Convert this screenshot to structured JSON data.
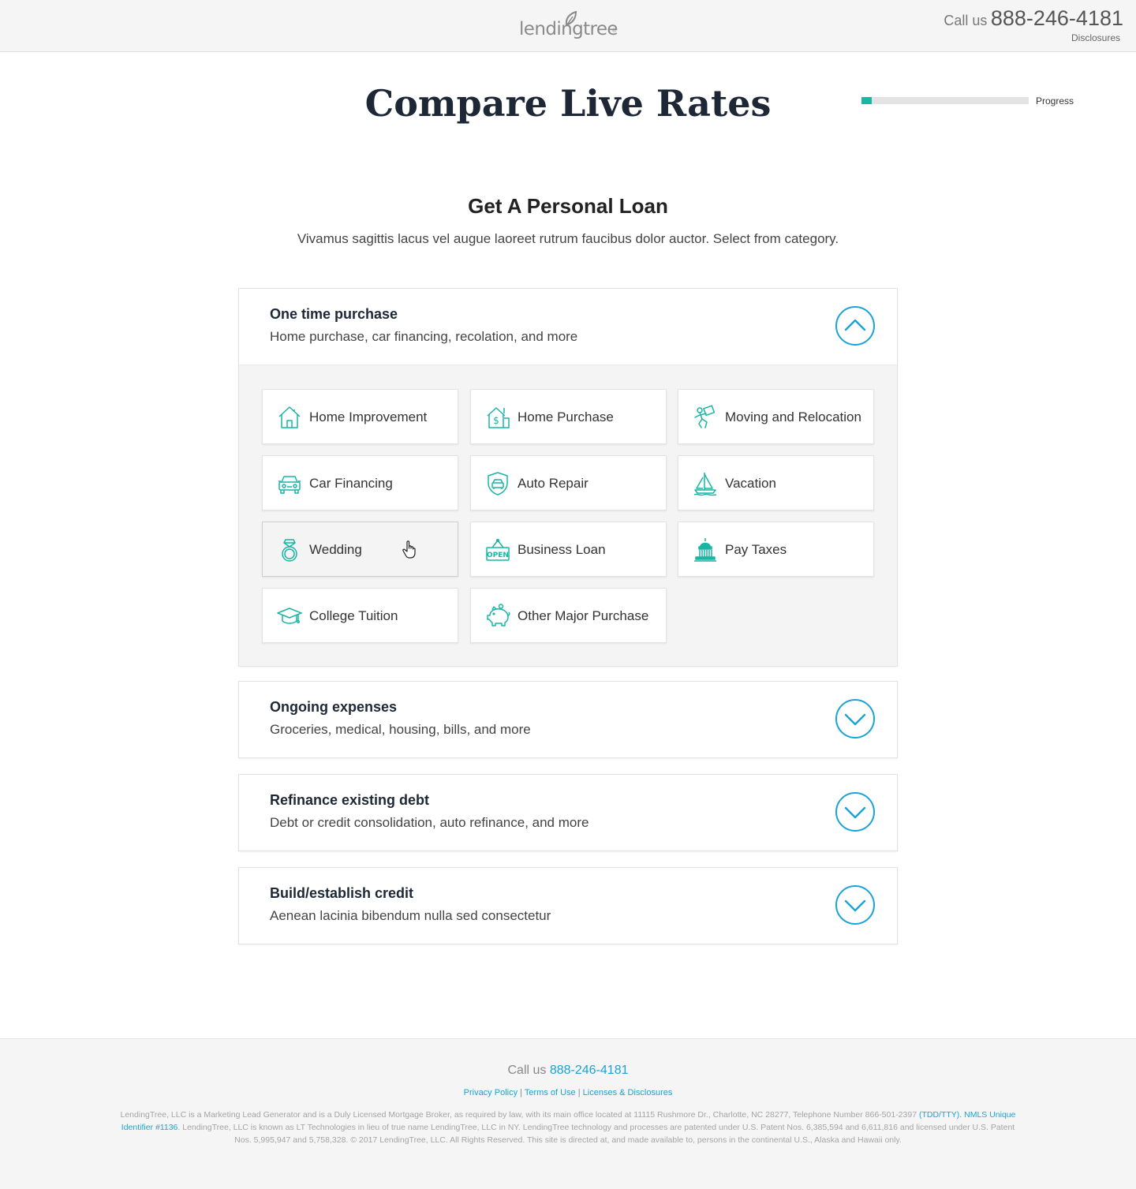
{
  "header": {
    "logo": "lendingtree",
    "call_label": "Call us",
    "phone": "888-246-4181",
    "disclosures": "Disclosures"
  },
  "page": {
    "title": "Compare Live Rates",
    "progress_label": "Progress",
    "progress_value": 0.06
  },
  "intro": {
    "title": "Get A Personal Loan",
    "subtitle": "Vivamus sagittis lacus vel augue laoreet rutrum faucibus dolor auctor. Select from category."
  },
  "categories": [
    {
      "title": "One time purchase",
      "desc": "Home purchase, car financing, recolation, and more",
      "expanded": true,
      "toggle_icon": "chevron-up-icon",
      "options": [
        {
          "label": "Home Improvement",
          "icon": "house-icon"
        },
        {
          "label": "Home Purchase",
          "icon": "house-dollar-icon"
        },
        {
          "label": "Moving and Relocation",
          "icon": "mover-icon"
        },
        {
          "label": "Car Financing",
          "icon": "car-icon"
        },
        {
          "label": "Auto Repair",
          "icon": "car-shield-icon"
        },
        {
          "label": "Vacation",
          "icon": "sailboat-icon"
        },
        {
          "label": "Wedding",
          "icon": "ring-icon"
        },
        {
          "label": "Business Loan",
          "icon": "open-sign-icon"
        },
        {
          "label": "Pay Taxes",
          "icon": "capitol-icon"
        },
        {
          "label": "College Tuition",
          "icon": "graduation-cap-icon"
        },
        {
          "label": "Other Major Purchase",
          "icon": "piggy-bank-icon"
        }
      ]
    },
    {
      "title": "Ongoing expenses",
      "desc": "Groceries, medical, housing, bills, and more",
      "expanded": false,
      "toggle_icon": "chevron-down-icon"
    },
    {
      "title": "Refinance existing debt",
      "desc": "Debt or credit consolidation, auto refinance, and more",
      "expanded": false,
      "toggle_icon": "chevron-down-icon"
    },
    {
      "title": "Build/establish credit",
      "desc": "Aenean lacinia bibendum nulla sed consectetur",
      "expanded": false,
      "toggle_icon": "chevron-down-icon"
    }
  ],
  "footer": {
    "call_label": "Call us",
    "phone": "888-246-4181",
    "links": [
      "Privacy Policy",
      "Terms of Use",
      "Licenses & Disclosures"
    ],
    "separator": "|",
    "legal_1": "LendingTree, LLC is a Marketing Lead Generator and is a Duly Licensed Mortgage Broker, as required by law, with its main office located at 11115 Rushmore Dr., Charlotte, NC 28277, Telephone Number 866-501-2397",
    "legal_link": "(TDD/TTY). NMLS Unique Identifier #1136",
    "legal_2": ". LendingTree, LLC is known as LT Technologies in lieu of true name LendingTree, LLC in NY. LendingTree technology and processes are patented under U.S. Patent Nos. 6,385,594 and 6,611,816 and licensed under U.S. Patent Nos. 5,995,947 and 5,758,328. © 2017 LendingTree, LLC. All Rights Reserved. This site is directed at, and made available to, persons in the continental U.S., Alaska and Hawaii only."
  },
  "colors": {
    "accent": "#1aa3d9",
    "icon": "#19b5a5",
    "title": "#1d2736"
  }
}
